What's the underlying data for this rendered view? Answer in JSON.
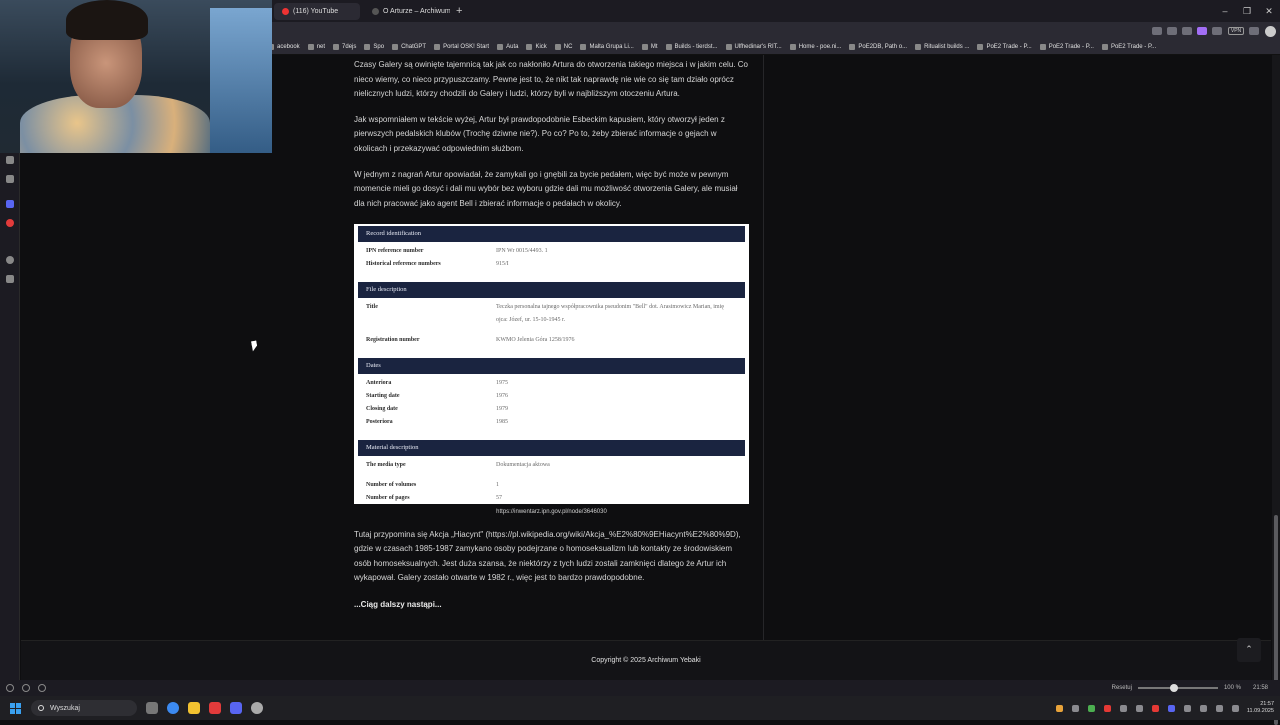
{
  "browser": {
    "tabs": [
      {
        "label": "(116) YouTube",
        "active": true,
        "favicon_color": "#e33"
      },
      {
        "label": "O Arturze – Archiwum Yebi",
        "active": false,
        "favicon_color": "#555"
      }
    ],
    "new_tab_label": "+",
    "window_controls": [
      "–",
      "❐",
      "✕"
    ],
    "vpn_label": "VPN",
    "bookmarks": [
      "acebook",
      "net",
      "7dejs",
      "Spo",
      "ChatGPT",
      "Portal OSK! Start",
      "Auta",
      "Kick",
      "NC",
      "Malta Grupa Li...",
      "Mt",
      "Builds - tierdst...",
      "Ulfhedinar's RIT...",
      "Home - poe.ni...",
      "PoE2DB, Path o...",
      "Ritualist builds ...",
      "PoE2 Trade - P...",
      "PoE2 Trade - P...",
      "PoE2 Trade - P..."
    ]
  },
  "article": {
    "paragraphs": [
      "Czasy Galery są owinięte tajemnicą tak jak co nakłoniło Artura do otworzenia takiego miejsca i w jakim celu. Co nieco wiemy, co nieco przypuszczamy. Pewne jest to, że nikt tak naprawdę nie wie co się tam działo oprócz nielicznych ludzi, którzy chodzili do Galery i ludzi, którzy byli w najbliższym otoczeniu Artura.",
      "Jak wspomniałem w tekście wyżej, Artur był prawdopodobnie Esbeckim kapusiem, który otworzył jeden z pierwszych pedalskich klubów (Trochę dziwne nie?). Po co? Po to, żeby zbierać informacje o gejach w okolicach i przekazywać odpowiednim służbom.",
      "W jednym z nagrań Artur opowiadał, że zamykali go i gnębili za bycie pedałem, więc być może w pewnym momencie mieli go dosyć i dali mu wybór bez wyboru gdzie dali mu możliwość otworzenia Galery, ale musiał dla nich pracować jako agent Bell i zbierać informacje o pedałach w okolicy."
    ],
    "record": {
      "sections": [
        {
          "title": "Record identification",
          "rows": [
            {
              "k": "IPN reference number",
              "v": "IPN Wr 0015/4493. 1"
            },
            {
              "k": "Historical reference numbers",
              "v": "915/I"
            }
          ]
        },
        {
          "title": "File description",
          "rows": [
            {
              "k": "Title",
              "v": "Teczka personalna tajnego współpracownika pseudonim \"Bell\" dot. Arasimowicz Marian, imię ojca: Józef, ur. 15-10-1945 r."
            },
            {
              "k": "Registration number",
              "v": "KWMO Jelenia Góra 1258/1976"
            }
          ]
        },
        {
          "title": "Dates",
          "rows": [
            {
              "k": "Anteriora",
              "v": "1975"
            },
            {
              "k": "Starting date",
              "v": "1976"
            },
            {
              "k": "Closing date",
              "v": "1979"
            },
            {
              "k": "Posteriora",
              "v": "1985"
            }
          ]
        },
        {
          "title": "Material description",
          "rows": [
            {
              "k": "The media type",
              "v": "Dokumentacja aktowa"
            },
            {
              "k": "Number of volumes",
              "v": "1"
            },
            {
              "k": "Number of pages",
              "v": "57"
            }
          ]
        }
      ]
    },
    "caption": "https://inwentarz.ipn.gov.pl/node/3646030",
    "after_paragraph": "Tutaj przypomina się Akcja „Hiacynt\" (https://pl.wikipedia.org/wiki/Akcja_%E2%80%9EHiacynt%E2%80%9D), gdzie w czasach 1985-1987 zamykano osoby podejrzane o homoseksualizm lub kontakty ze środowiskiem osób homoseksualnych. Jest duża szansa, że niektórzy z tych ludzi zostali zamknięci dlatego że Artur ich wykapował. Galery zostało otwarte w 1982 r., więc jest to bardzo prawdopodobne.",
    "more": "...Ciąg dalszy nastąpi..."
  },
  "footer": {
    "copyright": "Copyright © 2025 Archiwum Yebaki",
    "to_top": "⌃"
  },
  "statusbar": {
    "reset": "Resetuj",
    "zoom": "100 %",
    "time": "21:58",
    "zoom_level": 0.4
  },
  "taskbar": {
    "search_placeholder": "Wyszukaj",
    "time": "21:57",
    "date": "11.09.2025"
  }
}
